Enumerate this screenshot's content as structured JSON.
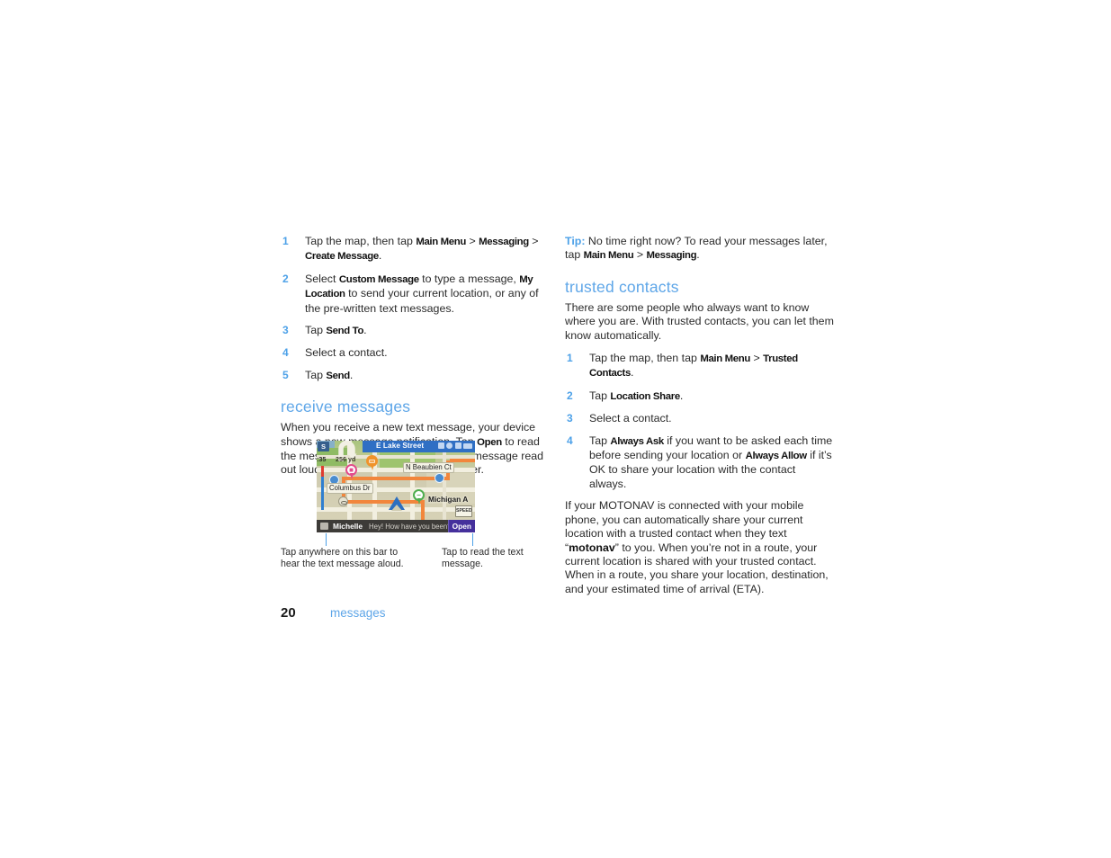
{
  "document": {
    "page_number": "20",
    "section_label": "messages"
  },
  "left_column": {
    "steps_create_message": [
      {
        "num": "1",
        "parts": [
          {
            "t": "Tap the map, then tap ",
            "b": false
          },
          {
            "t": "Main Menu",
            "b": true
          },
          {
            "t": " > ",
            "b": false
          },
          {
            "t": "Messaging",
            "b": true
          },
          {
            "t": " > ",
            "b": false
          },
          {
            "t": "Create Message",
            "b": true
          },
          {
            "t": ".",
            "b": false
          }
        ]
      },
      {
        "num": "2",
        "parts": [
          {
            "t": "Select ",
            "b": false
          },
          {
            "t": "Custom Message",
            "b": true
          },
          {
            "t": " to type a message, ",
            "b": false
          },
          {
            "t": "My Location",
            "b": true
          },
          {
            "t": " to send your current location, or any of the pre-written text messages.",
            "b": false
          }
        ]
      },
      {
        "num": "3",
        "parts": [
          {
            "t": "Tap ",
            "b": false
          },
          {
            "t": "Send To",
            "b": true
          },
          {
            "t": ".",
            "b": false
          }
        ]
      },
      {
        "num": "4",
        "parts": [
          {
            "t": "Select a contact.",
            "b": false
          }
        ]
      },
      {
        "num": "5",
        "parts": [
          {
            "t": "Tap ",
            "b": false
          },
          {
            "t": "Send",
            "b": true
          },
          {
            "t": ".",
            "b": false
          }
        ]
      }
    ],
    "receive_messages": {
      "heading": "receive messages",
      "paragraph_parts": [
        {
          "t": "When you receive a new text message, your device shows a new message notification. Tap ",
          "b": false
        },
        {
          "t": "Open",
          "b": true
        },
        {
          "t": " to read the message or say “open” to hear the message read out loud. You can reply to call the sender.",
          "b": false
        }
      ]
    },
    "figure_captions": {
      "left": "Tap anywhere on this bar to hear the text message aloud.",
      "right": "Tap to read the text message."
    }
  },
  "device_screenshot": {
    "status_bar": {
      "satellite_badge": "S",
      "eta": ":35",
      "distance": "256 yd",
      "street_name": "E Lake Street",
      "icons": [
        "volume-icon",
        "mute-icon",
        "bluetooth-icon",
        "battery-icon"
      ]
    },
    "map_labels": [
      "N Beaubien Ct",
      "Columbus Dr",
      "Michigan A"
    ],
    "speed_limit_sign": "SPEED",
    "message_bar": {
      "sender": "Michelle",
      "message": "Hey! How have you been?",
      "open_button": "Open"
    }
  },
  "right_column": {
    "tip": {
      "label": "Tip:",
      "parts": [
        {
          "t": " No time right now? To read your messages later, tap ",
          "b": false
        },
        {
          "t": "Main Menu",
          "b": true
        },
        {
          "t": " > ",
          "b": false
        },
        {
          "t": "Messaging",
          "b": true
        },
        {
          "t": ".",
          "b": false
        }
      ]
    },
    "trusted_contacts": {
      "heading": "trusted contacts",
      "intro": "There are some people who always want to know where you are. With trusted contacts, you can let them know automatically.",
      "steps": [
        {
          "num": "1",
          "parts": [
            {
              "t": "Tap the map, then tap ",
              "b": false
            },
            {
              "t": "Main Menu",
              "b": true
            },
            {
              "t": " > ",
              "b": false
            },
            {
              "t": "Trusted Contacts",
              "b": true
            },
            {
              "t": ".",
              "b": false
            }
          ]
        },
        {
          "num": "2",
          "parts": [
            {
              "t": "Tap ",
              "b": false
            },
            {
              "t": "Location Share",
              "b": true
            },
            {
              "t": ".",
              "b": false
            }
          ]
        },
        {
          "num": "3",
          "parts": [
            {
              "t": "Select a contact.",
              "b": false
            }
          ]
        },
        {
          "num": "4",
          "parts": [
            {
              "t": "Tap ",
              "b": false
            },
            {
              "t": "Always Ask",
              "b": true
            },
            {
              "t": " if you want to be asked each time before sending your location or ",
              "b": false
            },
            {
              "t": "Always Allow",
              "b": true
            },
            {
              "t": " if it’s OK to share your location with the contact always.",
              "b": false
            }
          ]
        }
      ],
      "closing_parts": [
        {
          "t": "If your MOTONAV is connected with your mobile phone, you can automatically share your current location with a trusted contact when they text “",
          "b": false
        },
        {
          "t": "motonav",
          "b": true
        },
        {
          "t": "” to you. When you’re not in a route, your current location is shared with your trusted contact. When in a route, you share your location, destination, and your estimated time of arrival (ETA).",
          "b": false
        }
      ]
    }
  },
  "colors": {
    "accent_blue": "#5ea6e8",
    "list_number_blue": "#4da1e8",
    "body_text": "#2b2b2b",
    "route_orange": "#f2863c",
    "street_bar_blue": "#2f6fc4",
    "open_button_purple": "#45309c"
  }
}
